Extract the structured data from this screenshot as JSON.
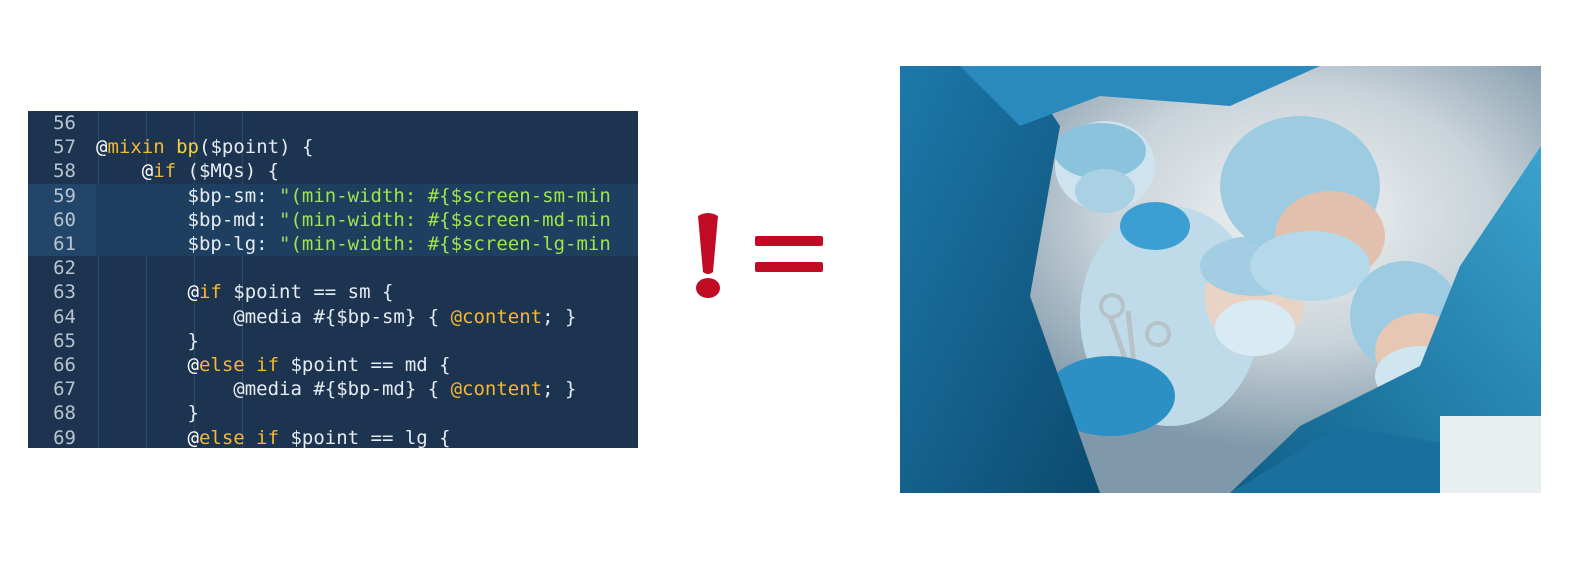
{
  "code": {
    "lines": [
      {
        "n": "56",
        "tokens": []
      },
      {
        "n": "57",
        "tokens": [
          {
            "t": "@",
            "c": "at"
          },
          {
            "t": "mixin",
            "c": "kw"
          },
          {
            "t": " ",
            "c": "pl"
          },
          {
            "t": "bp",
            "c": "fn"
          },
          {
            "t": "($point) {",
            "c": "pl"
          }
        ]
      },
      {
        "n": "58",
        "tokens": [
          {
            "t": "    @",
            "c": "at"
          },
          {
            "t": "if",
            "c": "kw"
          },
          {
            "t": " ($MQs) {",
            "c": "pl"
          }
        ]
      },
      {
        "n": "59",
        "tokens": [
          {
            "t": "        $bp-sm: ",
            "c": "pl"
          },
          {
            "t": "\"(min-width: #{$screen-sm-min",
            "c": "str"
          }
        ]
      },
      {
        "n": "60",
        "tokens": [
          {
            "t": "        $bp-md: ",
            "c": "pl"
          },
          {
            "t": "\"(min-width: #{$screen-md-min",
            "c": "str"
          }
        ]
      },
      {
        "n": "61",
        "tokens": [
          {
            "t": "        $bp-lg: ",
            "c": "pl"
          },
          {
            "t": "\"(min-width: #{$screen-lg-min",
            "c": "str"
          }
        ]
      },
      {
        "n": "62",
        "tokens": []
      },
      {
        "n": "63",
        "tokens": [
          {
            "t": "        @",
            "c": "at"
          },
          {
            "t": "if",
            "c": "kw"
          },
          {
            "t": " $point == sm {",
            "c": "pl"
          }
        ]
      },
      {
        "n": "64",
        "tokens": [
          {
            "t": "            @media #{$bp-sm} { ",
            "c": "pl"
          },
          {
            "t": "@content",
            "c": "kw"
          },
          {
            "t": "; }",
            "c": "pl"
          }
        ]
      },
      {
        "n": "65",
        "tokens": [
          {
            "t": "        }",
            "c": "pl"
          }
        ]
      },
      {
        "n": "66",
        "tokens": [
          {
            "t": "        @",
            "c": "at"
          },
          {
            "t": "else if",
            "c": "kw"
          },
          {
            "t": " $point == md {",
            "c": "pl"
          }
        ]
      },
      {
        "n": "67",
        "tokens": [
          {
            "t": "            @media #{$bp-md} { ",
            "c": "pl"
          },
          {
            "t": "@content",
            "c": "kw"
          },
          {
            "t": "; }",
            "c": "pl"
          }
        ]
      },
      {
        "n": "68",
        "tokens": [
          {
            "t": "        }",
            "c": "pl"
          }
        ]
      },
      {
        "n": "69",
        "tokens": [
          {
            "t": "        @",
            "c": "at"
          },
          {
            "t": "else if",
            "c": "kw"
          },
          {
            "t": " $point == lg {",
            "c": "pl"
          }
        ]
      }
    ],
    "highlighted_lines": [
      "59",
      "60",
      "61"
    ]
  },
  "symbol": {
    "name": "not-equal-icon",
    "color": "#c10b25"
  },
  "photo": {
    "subject": "surgeons-operating-icon"
  },
  "colors": {
    "code_bg": "#1c344f",
    "keyword": "#f5b82e",
    "string": "#9fe44a"
  }
}
